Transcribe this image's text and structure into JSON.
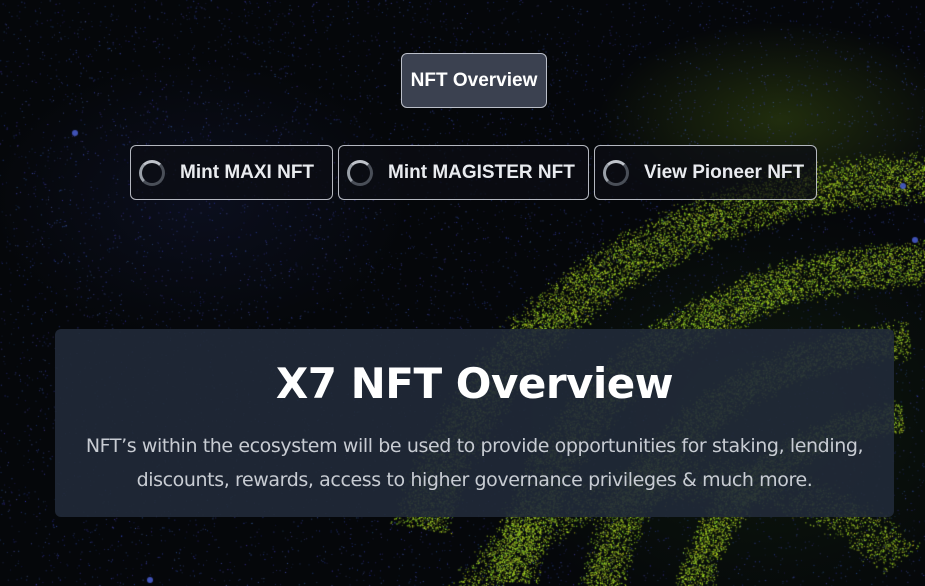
{
  "nav": {
    "overview_label": "NFT Overview",
    "mint_buttons": [
      {
        "label": "Mint MAXI NFT"
      },
      {
        "label": "Mint MAGISTER NFT"
      },
      {
        "label": "View Pioneer NFT"
      }
    ]
  },
  "panel": {
    "title": "X7 NFT Overview",
    "description_line1": "NFT’s within the ecosystem will be used to provide opportunities for staking, lending,",
    "description_line2": "discounts, rewards, access to higher governance privileges & much more."
  },
  "colors": {
    "background": "#05070a",
    "accent_green": "#b6ee2a",
    "star_blue": "#4a5ab8",
    "panel_bg": "#212a38",
    "primary_button_bg": "#3b4150"
  },
  "icons": {
    "loading": "spinner-icon"
  }
}
